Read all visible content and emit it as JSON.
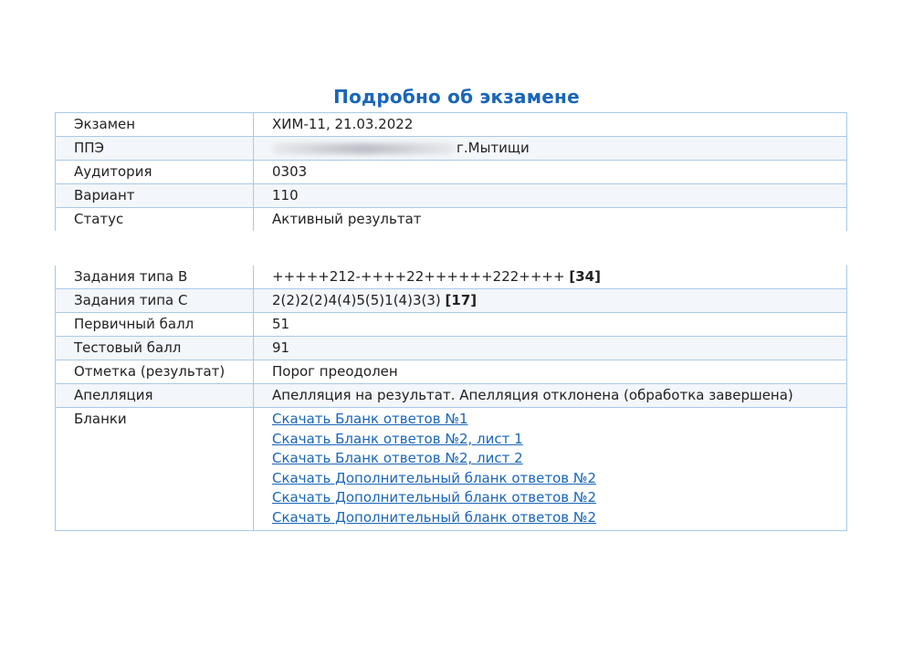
{
  "title": "Подробно об экзамене",
  "exam_info": {
    "rows": [
      {
        "label": "Экзамен",
        "value": "ХИМ-11, 21.03.2022"
      },
      {
        "label": "ППЭ",
        "value": "г.Мытищи"
      },
      {
        "label": "Аудитория",
        "value": "0303"
      },
      {
        "label": "Вариант",
        "value": "110"
      },
      {
        "label": "Статус",
        "value": "Активный результат"
      }
    ]
  },
  "results": {
    "type_b": {
      "label": "Задания типа B",
      "answers": "+++++212-++++22++++++222++++",
      "score": "[34]"
    },
    "type_c": {
      "label": "Задания типа C",
      "answers": "2(2)2(2)4(4)5(5)1(4)3(3)",
      "score": "[17]"
    },
    "primary": {
      "label": "Первичный балл",
      "value": "51"
    },
    "test": {
      "label": "Тестовый балл",
      "value": "91"
    },
    "mark": {
      "label": "Отметка (результат)",
      "value": "Порог преодолен"
    },
    "appeal": {
      "label": "Апелляция",
      "value": "Апелляция на результат. Апелляция отклонена (обработка завершена)"
    },
    "forms": {
      "label": "Бланки",
      "links": [
        "Скачать Бланк ответов №1",
        "Скачать Бланк ответов №2, лист 1",
        "Скачать Бланк ответов №2, лист 2",
        "Скачать Дополнительный бланк ответов №2",
        "Скачать Дополнительный бланк ответов №2",
        "Скачать Дополнительный бланк ответов №2"
      ]
    }
  },
  "colors": {
    "title": "#1a66b8",
    "link": "#1a66b8",
    "border": "#a9c8e8",
    "row_alt": "#f3f6fa"
  }
}
